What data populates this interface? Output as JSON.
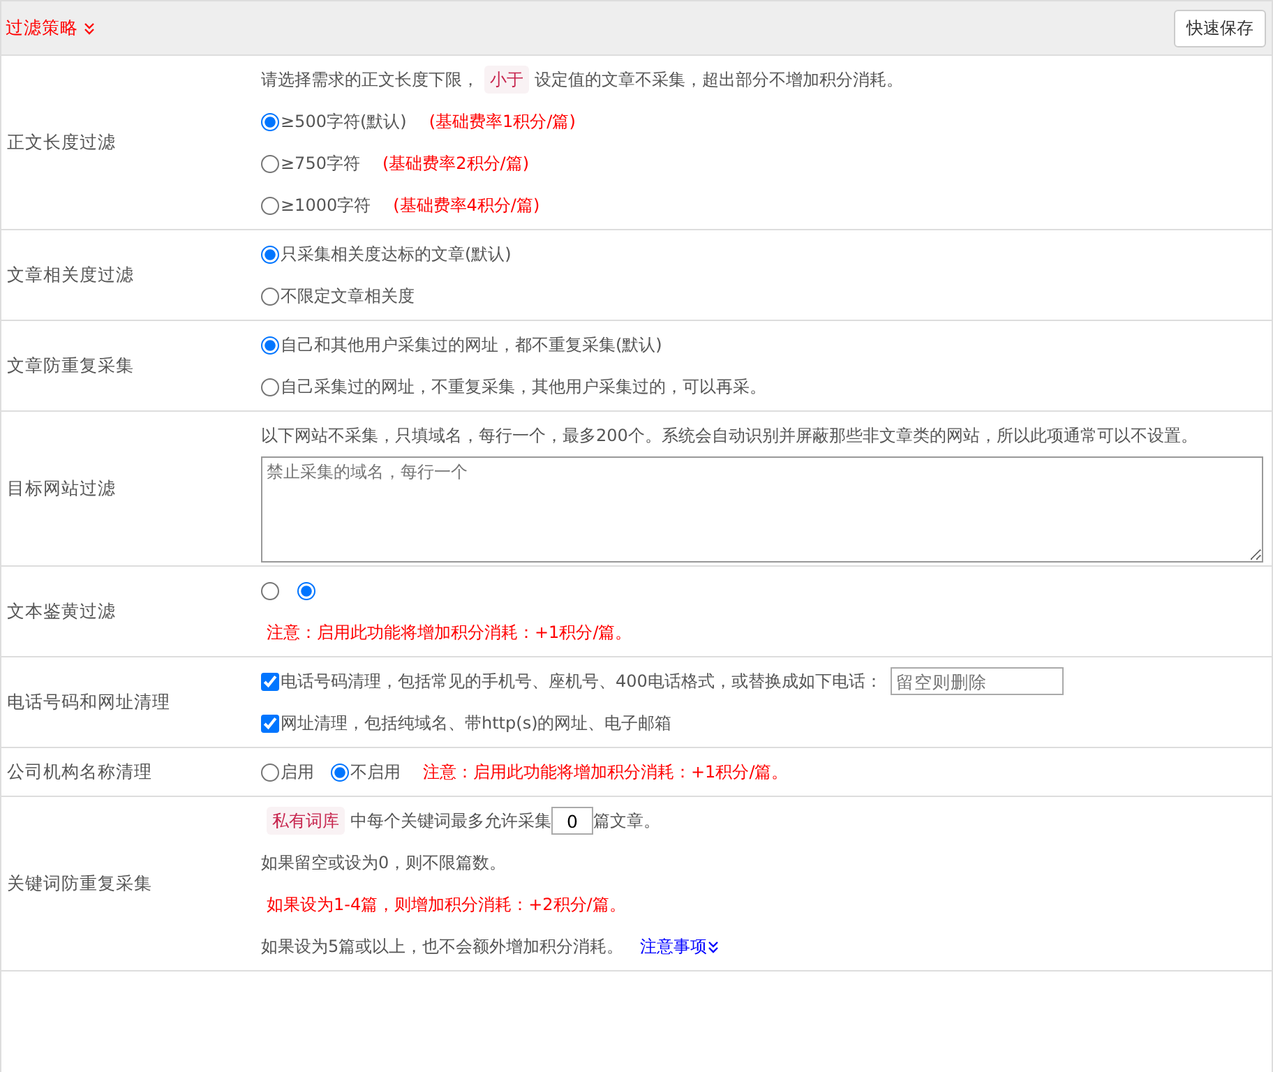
{
  "header": {
    "title": "过滤策略",
    "save_button": "快速保存"
  },
  "rows": [
    {
      "label": "正文长度过滤",
      "lines": [
        [
          {
            "kind": "text",
            "text": "请选择需求的正文长度下限，"
          },
          {
            "kind": "tag",
            "text": "小于"
          },
          {
            "kind": "text",
            "text": "设定值的文章不采集，超出部分不增加积分消耗。"
          }
        ],
        [
          {
            "kind": "radio",
            "label": "≥500字符(默认)",
            "selected": true
          },
          {
            "kind": "red",
            "text": "(基础费率1积分/篇)"
          }
        ],
        [
          {
            "kind": "radio",
            "label": "≥750字符",
            "selected": false
          },
          {
            "kind": "red",
            "text": "(基础费率2积分/篇)"
          }
        ],
        [
          {
            "kind": "radio",
            "label": "≥1000字符",
            "selected": false
          },
          {
            "kind": "red",
            "text": "(基础费率4积分/篇)"
          }
        ]
      ]
    },
    {
      "label": "文章相关度过滤",
      "lines": [
        [
          {
            "kind": "radio",
            "label": "只采集相关度达标的文章(默认)",
            "selected": true
          }
        ],
        [
          {
            "kind": "radio",
            "label": "不限定文章相关度",
            "selected": false
          }
        ]
      ]
    },
    {
      "label": "文章防重复采集",
      "lines": [
        [
          {
            "kind": "radio",
            "label": "自己和其他用户采集过的网址，都不重复采集(默认)",
            "selected": true
          }
        ],
        [
          {
            "kind": "radio",
            "label": "自己采集过的网址，不重复采集，其他用户采集过的，可以再采。",
            "selected": false
          }
        ]
      ]
    },
    {
      "label": "目标网站过滤",
      "lines": [
        [
          {
            "kind": "text",
            "text": "以下网站不采集，只填域名，每行一个，最多200个。系统会自动识别并屏蔽那些非文章类的网站，所以此项通常可以不设置。"
          }
        ],
        [
          {
            "kind": "textarea",
            "placeholder": "禁止采集的域名，每行一个"
          }
        ]
      ]
    },
    {
      "label": "文本鉴黄过滤",
      "lines": [
        [
          {
            "kind": "radio",
            "selected": false
          },
          {
            "kind": "radio",
            "selected": true
          }
        ],
        [
          {
            "kind": "red",
            "text": "注意：启用此功能将增加积分消耗：+1积分/篇。"
          }
        ]
      ]
    },
    {
      "label": "电话号码和网址清理",
      "lines": [
        [
          {
            "kind": "checkbox",
            "label": "电话号码清理，包括常见的手机号、座机号、400电话格式，或替换成如下电话：",
            "checked": true
          },
          {
            "kind": "input",
            "placeholder": "留空则删除"
          }
        ],
        [
          {
            "kind": "checkbox",
            "label": "网址清理，包括纯域名、带http(s)的网址、电子邮箱",
            "checked": true
          }
        ]
      ]
    },
    {
      "label": "公司机构名称清理",
      "lines": [
        [
          {
            "kind": "radio",
            "label": "启用",
            "selected": false
          },
          {
            "kind": "radio",
            "label": "不启用",
            "selected": true
          },
          {
            "kind": "red",
            "text": "注意：启用此功能将增加积分消耗：+1积分/篇。"
          }
        ]
      ]
    },
    {
      "label": "关键词防重复采集",
      "lines": [
        [
          {
            "kind": "tag",
            "text": "私有词库"
          },
          {
            "kind": "text",
            "text": "中每个关键词最多允许采集"
          },
          {
            "kind": "number",
            "value": "0"
          },
          {
            "kind": "text",
            "text": "篇文章。"
          }
        ],
        [
          {
            "kind": "text",
            "text": "如果留空或设为0，则不限篇数。"
          }
        ],
        [
          {
            "kind": "red",
            "text": "如果设为1-4篇，则增加积分消耗：+2积分/篇。"
          }
        ],
        [
          {
            "kind": "text",
            "text": "如果设为5篇或以上，也不会额外增加积分消耗。"
          },
          {
            "kind": "link",
            "text": "注意事项"
          }
        ]
      ]
    }
  ]
}
